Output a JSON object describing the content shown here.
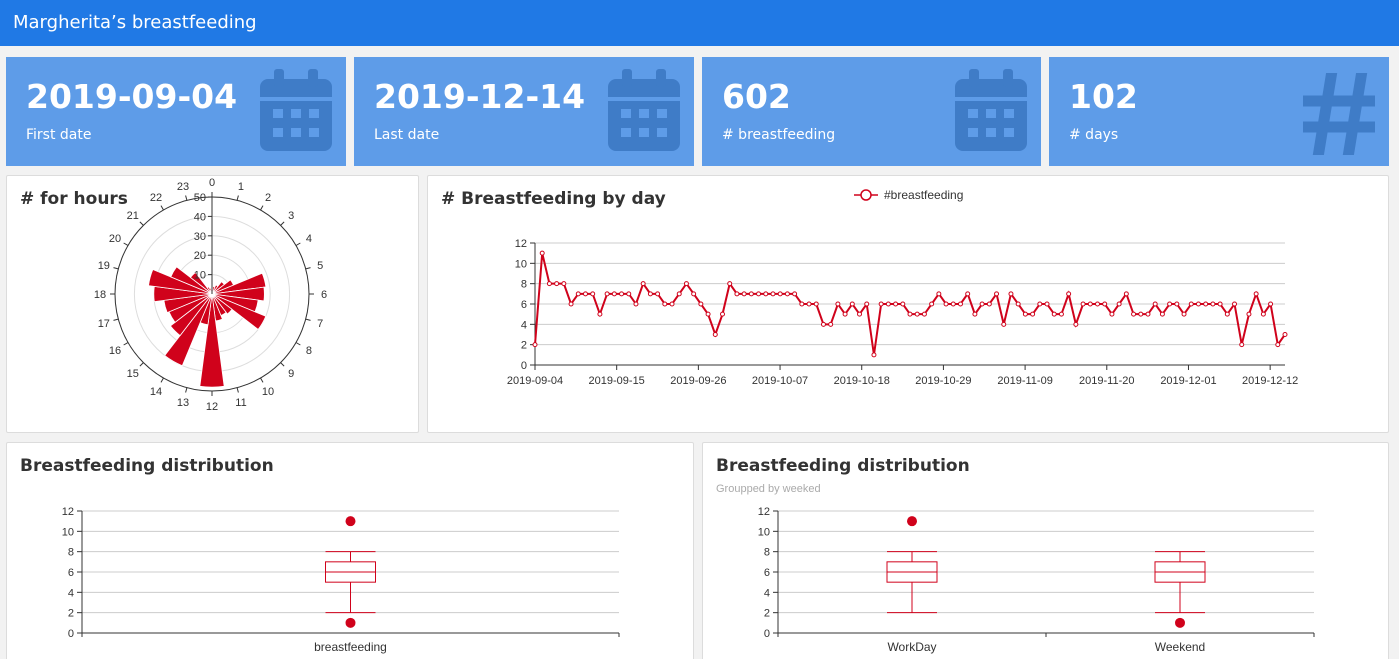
{
  "app": {
    "title": "Margherita’s breastfeeding"
  },
  "kpis": [
    {
      "value": "2019-09-04",
      "caption": "First date",
      "icon": "calendar-icon"
    },
    {
      "value": "2019-12-14",
      "caption": "Last date",
      "icon": "calendar-icon"
    },
    {
      "value": "602",
      "caption": "# breastfeeding",
      "icon": "calendar-icon"
    },
    {
      "value": "102",
      "caption": "# days",
      "icon": "hash-icon"
    }
  ],
  "colors": {
    "nav": "#2079e5",
    "kpi": "#5e9ce8",
    "series": "#d0021b"
  },
  "cards": {
    "hours": {
      "title": "# for hours"
    },
    "byday": {
      "title": "# Breastfeeding by day"
    },
    "dist1": {
      "title": "Breastfeeding distribution"
    },
    "dist2": {
      "title": "Breastfeeding distribution",
      "subtitle": "Groupped by weeked"
    }
  },
  "chart_data": [
    {
      "type": "polar-bar",
      "title": "# for hours",
      "categories": [
        "0",
        "1",
        "2",
        "3",
        "4",
        "5",
        "6",
        "7",
        "8",
        "9",
        "10",
        "11",
        "12",
        "13",
        "14",
        "15",
        "16",
        "17",
        "18",
        "19",
        "20",
        "21",
        "22",
        "23"
      ],
      "values": [
        3,
        4,
        5,
        8,
        12,
        28,
        27,
        24,
        30,
        13,
        12,
        14,
        48,
        16,
        40,
        27,
        24,
        25,
        30,
        33,
        23,
        14,
        4,
        3
      ],
      "rlim": [
        0,
        50
      ],
      "rticks": [
        10,
        20,
        30,
        40,
        50
      ]
    },
    {
      "type": "line",
      "title": "# Breastfeeding by day",
      "legend": [
        "#breastfeeding"
      ],
      "x_ticks": [
        "2019-09-04",
        "2019-09-15",
        "2019-09-26",
        "2019-10-07",
        "2019-10-18",
        "2019-10-29",
        "2019-11-09",
        "2019-11-20",
        "2019-12-01",
        "2019-12-12"
      ],
      "x_start": "2019-09-04",
      "x_end": "2019-12-14",
      "ylim": [
        0,
        12
      ],
      "yticks": [
        0,
        2,
        4,
        6,
        8,
        10,
        12
      ],
      "series": [
        {
          "name": "#breastfeeding",
          "values": [
            2,
            11,
            8,
            8,
            8,
            6,
            7,
            7,
            7,
            5,
            7,
            7,
            7,
            7,
            6,
            8,
            7,
            7,
            6,
            6,
            7,
            8,
            7,
            6,
            5,
            3,
            5,
            8,
            7,
            7,
            7,
            7,
            7,
            7,
            7,
            7,
            7,
            6,
            6,
            6,
            4,
            4,
            6,
            5,
            6,
            5,
            6,
            1,
            6,
            6,
            6,
            6,
            5,
            5,
            5,
            6,
            7,
            6,
            6,
            6,
            7,
            5,
            6,
            6,
            7,
            4,
            7,
            6,
            5,
            5,
            6,
            6,
            5,
            5,
            7,
            4,
            6,
            6,
            6,
            6,
            5,
            6,
            7,
            5,
            5,
            5,
            6,
            5,
            6,
            6,
            5,
            6,
            6,
            6,
            6,
            6,
            5,
            6,
            2,
            5,
            7,
            5,
            6,
            2,
            3
          ]
        }
      ]
    },
    {
      "type": "boxplot",
      "title": "Breastfeeding distribution",
      "categories": [
        "breastfeeding"
      ],
      "boxes": [
        {
          "min": 2,
          "q1": 5,
          "median": 6,
          "q3": 7,
          "max": 8,
          "outliers": [
            11,
            1
          ]
        }
      ],
      "ylim": [
        0,
        12
      ],
      "yticks": [
        0,
        2,
        4,
        6,
        8,
        10,
        12
      ]
    },
    {
      "type": "boxplot",
      "title": "Breastfeeding distribution",
      "subtitle": "Groupped by weeked",
      "categories": [
        "WorkDay",
        "Weekend"
      ],
      "boxes": [
        {
          "min": 2,
          "q1": 5,
          "median": 6,
          "q3": 7,
          "max": 8,
          "outliers": [
            11
          ]
        },
        {
          "min": 2,
          "q1": 5,
          "median": 6,
          "q3": 7,
          "max": 8,
          "outliers": [
            1
          ]
        }
      ],
      "ylim": [
        0,
        12
      ],
      "yticks": [
        0,
        2,
        4,
        6,
        8,
        10,
        12
      ]
    }
  ]
}
